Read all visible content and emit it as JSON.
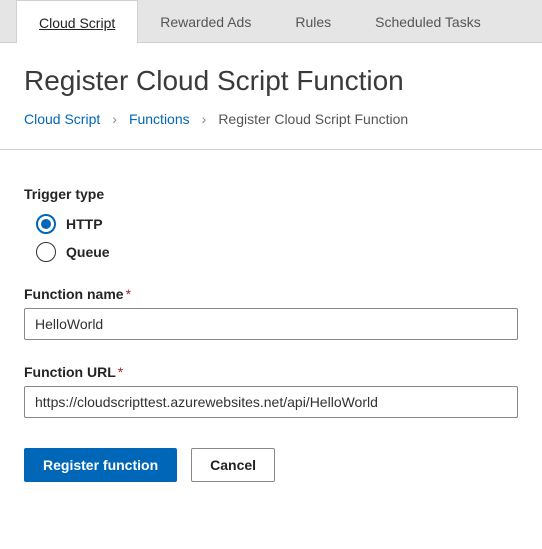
{
  "tabs": [
    {
      "label": "Cloud Script",
      "active": true
    },
    {
      "label": "Rewarded Ads",
      "active": false
    },
    {
      "label": "Rules",
      "active": false
    },
    {
      "label": "Scheduled Tasks",
      "active": false
    }
  ],
  "title": "Register Cloud Script Function",
  "breadcrumb": {
    "items": [
      {
        "label": "Cloud Script",
        "link": true
      },
      {
        "label": "Functions",
        "link": true
      },
      {
        "label": "Register Cloud Script Function",
        "link": false
      }
    ],
    "separator": "›"
  },
  "form": {
    "trigger": {
      "label": "Trigger type",
      "options": [
        {
          "label": "HTTP",
          "checked": true
        },
        {
          "label": "Queue",
          "checked": false
        }
      ]
    },
    "function_name": {
      "label": "Function name",
      "required": "*",
      "value": "HelloWorld"
    },
    "function_url": {
      "label": "Function URL",
      "required": "*",
      "value": "https://cloudscripttest.azurewebsites.net/api/HelloWorld"
    },
    "buttons": {
      "primary": "Register function",
      "secondary": "Cancel"
    }
  }
}
